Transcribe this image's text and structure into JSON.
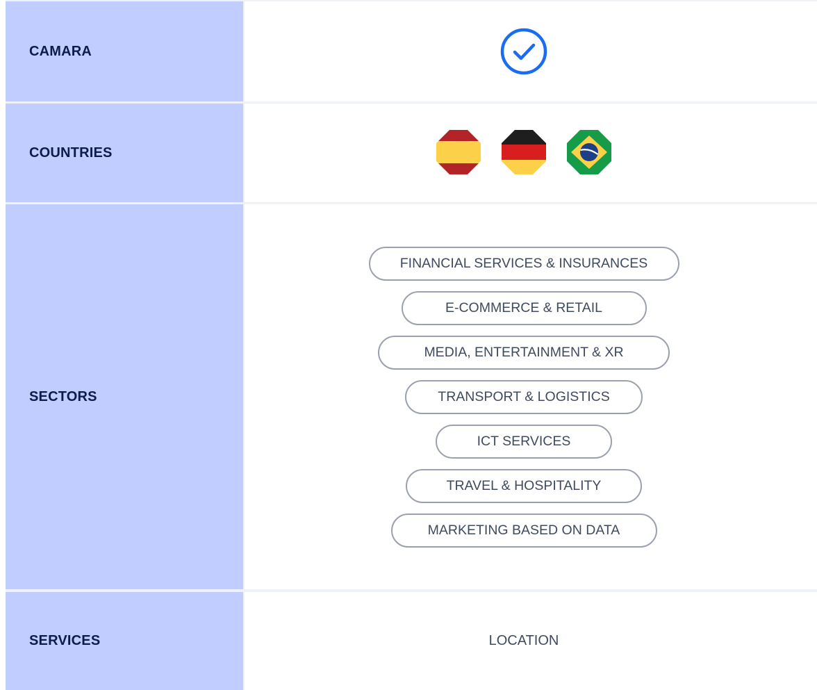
{
  "rows": {
    "camara": {
      "label": "CAMARA",
      "value_icon": "check-circle-icon",
      "checked": true
    },
    "countries": {
      "label": "COUNTRIES",
      "flags": [
        {
          "country": "Spain",
          "icon": "flag-spain-icon"
        },
        {
          "country": "Germany",
          "icon": "flag-germany-icon"
        },
        {
          "country": "Brazil",
          "icon": "flag-brazil-icon"
        }
      ]
    },
    "sectors": {
      "label": "SECTORS",
      "items": [
        "FINANCIAL SERVICES & INSURANCES",
        "E-COMMERCE & RETAIL",
        "MEDIA, ENTERTAINMENT & XR",
        "TRANSPORT & LOGISTICS",
        "ICT SERVICES",
        "TRAVEL & HOSPITALITY",
        "MARKETING BASED ON DATA"
      ]
    },
    "services": {
      "label": "SERVICES",
      "value": "LOCATION"
    }
  },
  "colors": {
    "label_background": "#c2cdff",
    "label_text": "#0c1c4a",
    "check_blue": "#1a6cf0",
    "pill_border": "#9aa1ae",
    "value_text": "#3f4a5e"
  }
}
